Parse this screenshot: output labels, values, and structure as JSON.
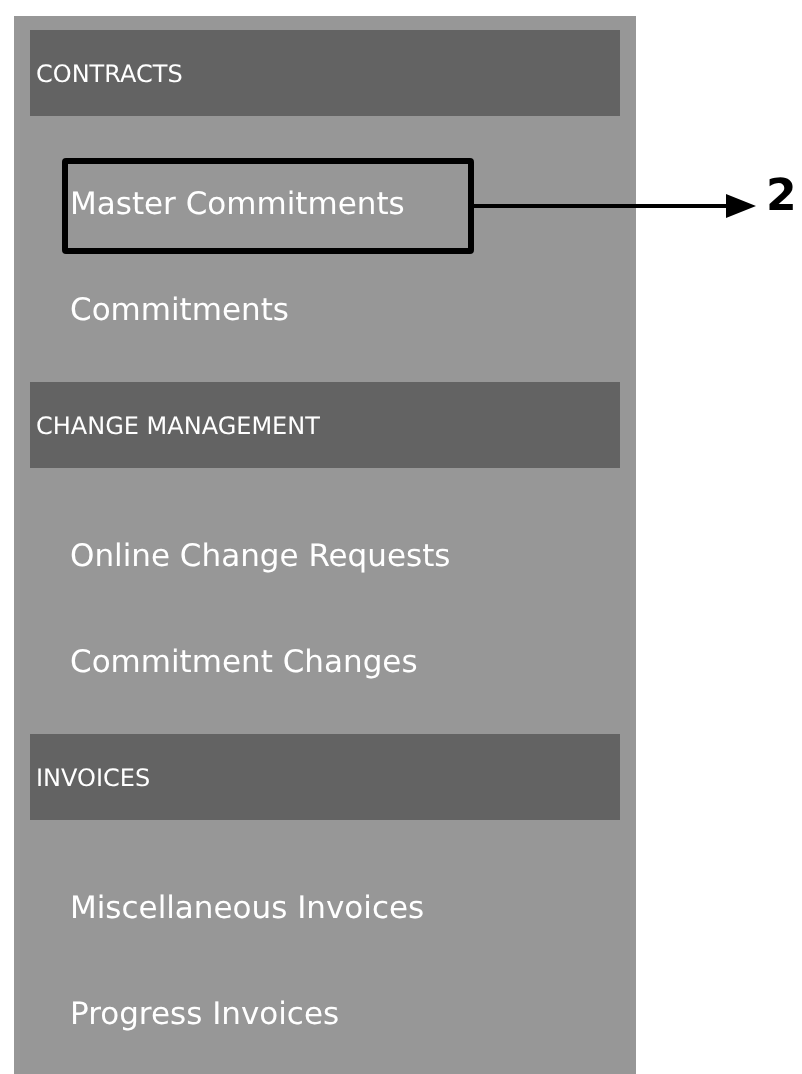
{
  "sidebar": {
    "sections": [
      {
        "title": "CONTRACTS",
        "items": [
          {
            "label": "Master Commitments",
            "highlighted": true,
            "callout": "2"
          },
          {
            "label": "Commitments",
            "highlighted": false
          }
        ]
      },
      {
        "title": "CHANGE MANAGEMENT",
        "items": [
          {
            "label": "Online Change Requests",
            "highlighted": false
          },
          {
            "label": "Commitment Changes",
            "highlighted": false
          }
        ]
      },
      {
        "title": "INVOICES",
        "items": [
          {
            "label": "Miscellaneous Invoices",
            "highlighted": false
          },
          {
            "label": "Progress Invoices",
            "highlighted": false
          }
        ]
      }
    ]
  }
}
